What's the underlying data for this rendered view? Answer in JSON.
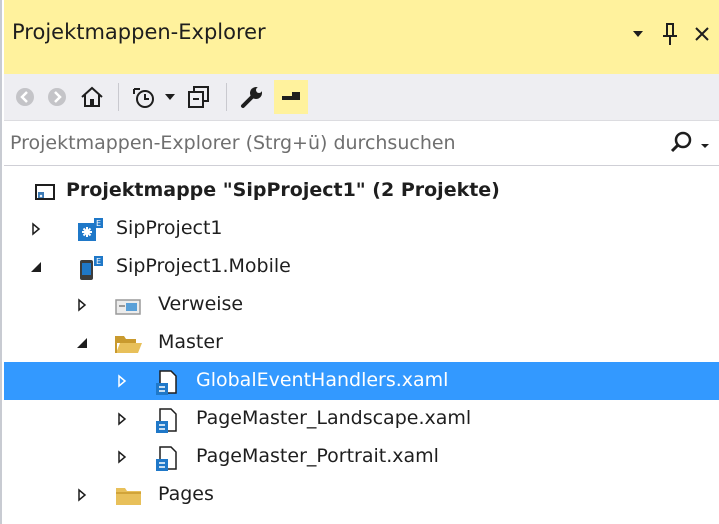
{
  "window": {
    "title": "Projektmappen-Explorer",
    "accent_color": "#fff29d",
    "selection_color": "#3399ff"
  },
  "title_controls": {
    "dropdown_icon": "caret-down-icon",
    "pin_icon": "pin-icon",
    "close_icon": "close-icon"
  },
  "toolbar": {
    "buttons": [
      {
        "icon": "back-icon"
      },
      {
        "icon": "forward-icon"
      },
      {
        "icon": "home-icon"
      },
      {
        "icon": "pending-changes-icon"
      },
      {
        "icon": "dropdown-arrow-icon"
      },
      {
        "icon": "collapse-all-icon"
      },
      {
        "icon": "properties-wrench-icon"
      },
      {
        "icon": "preview-selected-icon"
      }
    ]
  },
  "search": {
    "placeholder": "Projektmappen-Explorer (Strg+ü) durchsuchen",
    "value": ""
  },
  "tree": {
    "solution": "Projektmappe \"SipProject1\" (2 Projekte)",
    "items": [
      {
        "label": "SipProject1",
        "state": "collapsed",
        "icon": "project-icon"
      },
      {
        "label": "SipProject1.Mobile",
        "state": "expanded",
        "icon": "mobile-project-icon"
      },
      {
        "label": "Verweise",
        "state": "collapsed",
        "icon": "references-icon"
      },
      {
        "label": "Master",
        "state": "expanded",
        "icon": "folder-open-icon"
      },
      {
        "label": "GlobalEventHandlers.xaml",
        "state": "collapsed",
        "icon": "xaml-file-icon",
        "selected": true
      },
      {
        "label": "PageMaster_Landscape.xaml",
        "state": "collapsed",
        "icon": "xaml-file-icon"
      },
      {
        "label": "PageMaster_Portrait.xaml",
        "state": "collapsed",
        "icon": "xaml-file-icon"
      },
      {
        "label": "Pages",
        "state": "collapsed",
        "icon": "folder-icon"
      }
    ]
  }
}
